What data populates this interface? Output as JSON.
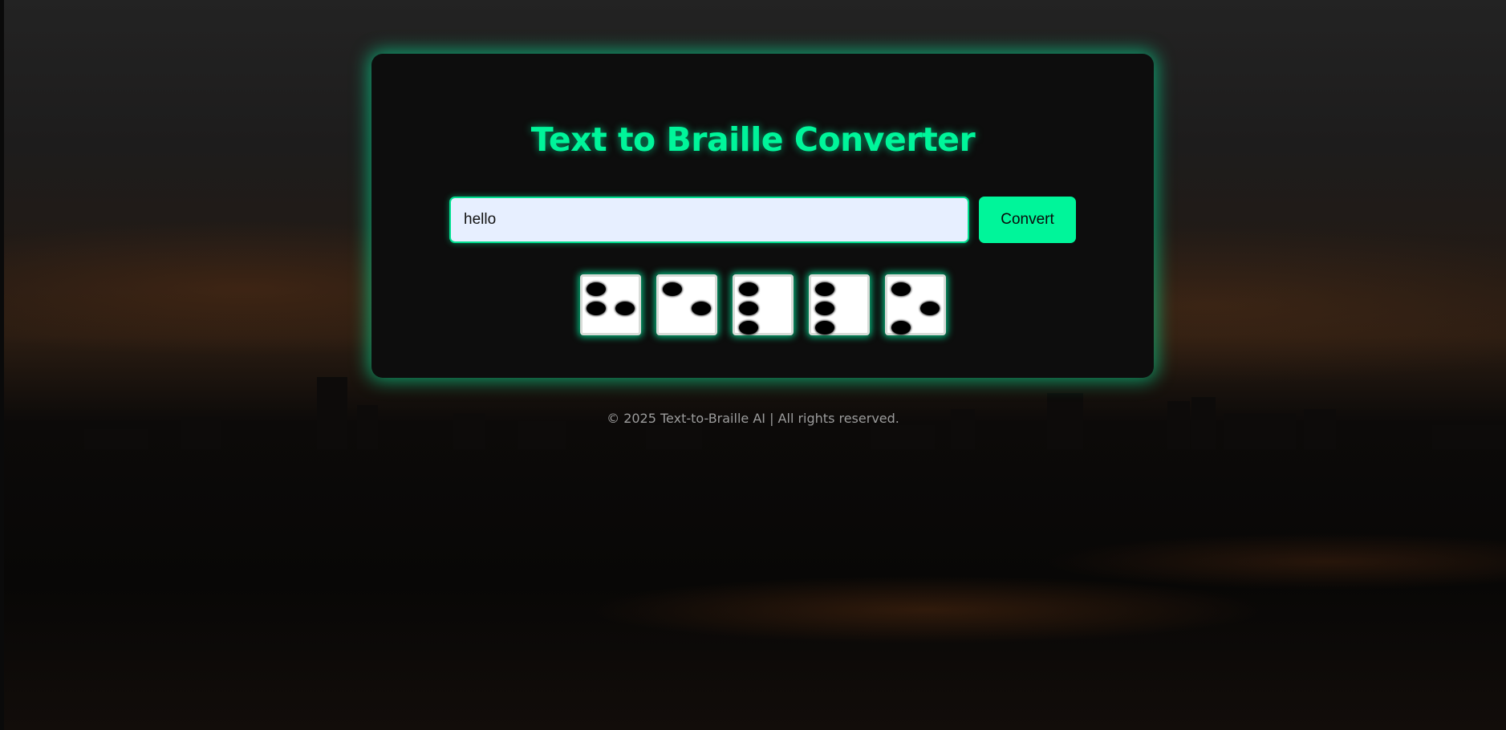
{
  "app": {
    "title": "Text to Braille Converter"
  },
  "form": {
    "input_value": "hello",
    "convert_label": "Convert"
  },
  "braille": {
    "cells": [
      {
        "letter": "h",
        "dots": [
          1,
          2,
          5
        ]
      },
      {
        "letter": "e",
        "dots": [
          1,
          5
        ]
      },
      {
        "letter": "l",
        "dots": [
          1,
          2,
          3
        ]
      },
      {
        "letter": "l",
        "dots": [
          1,
          2,
          3
        ]
      },
      {
        "letter": "o",
        "dots": [
          1,
          3,
          5
        ]
      }
    ]
  },
  "footer": {
    "text": "© 2025 Text-to-Braille AI | All rights reserved."
  },
  "colors": {
    "accent": "#00f59a",
    "card_background": "#0d0d0d",
    "input_background": "#e7efff",
    "footer_text": "#9c9c9c"
  }
}
